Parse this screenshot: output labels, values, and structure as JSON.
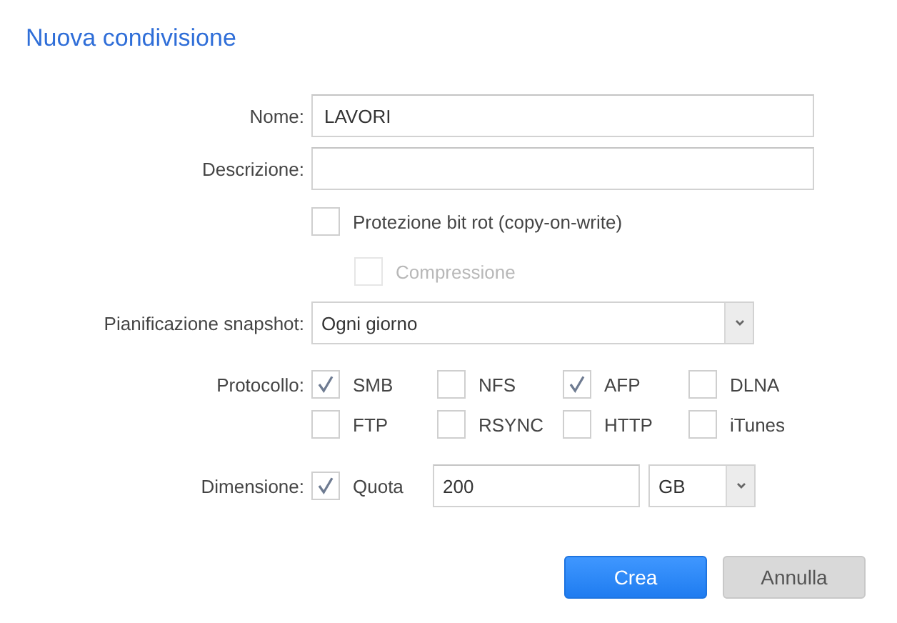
{
  "dialog": {
    "title": "Nuova condivisione"
  },
  "fields": [
    {
      "kind": "text",
      "label": "Nome:",
      "value": "LAVORI"
    },
    {
      "kind": "text",
      "label": "Descrizione:"
    }
  ],
  "options": [
    {
      "label": "Protezione bit rot (copy-on-write)",
      "checked": false,
      "disabled": false,
      "children": [
        {
          "label": "Compressione",
          "checked": false,
          "disabled": true
        }
      ]
    }
  ],
  "snapshot": {
    "label": "Pianificazione snapshot:",
    "value": "Ogni giorno"
  },
  "protocols": {
    "label": "Protocollo:",
    "items": [
      {
        "label": "SMB",
        "checked": true
      },
      {
        "label": "NFS",
        "checked": false
      },
      {
        "label": "AFP",
        "checked": true
      },
      {
        "label": "DLNA",
        "checked": false
      },
      {
        "label": "FTP",
        "checked": false
      },
      {
        "label": "RSYNC",
        "checked": false
      },
      {
        "label": "HTTP",
        "checked": false
      },
      {
        "label": "iTunes",
        "checked": false
      }
    ]
  },
  "size": {
    "label": "Dimensione:",
    "quota": {
      "label": "Quota",
      "checked": true
    },
    "value": "200",
    "unit": "GB"
  },
  "buttons": [
    {
      "label": "Crea",
      "kind": "primary"
    },
    {
      "label": "Annulla",
      "kind": "secondary"
    }
  ]
}
